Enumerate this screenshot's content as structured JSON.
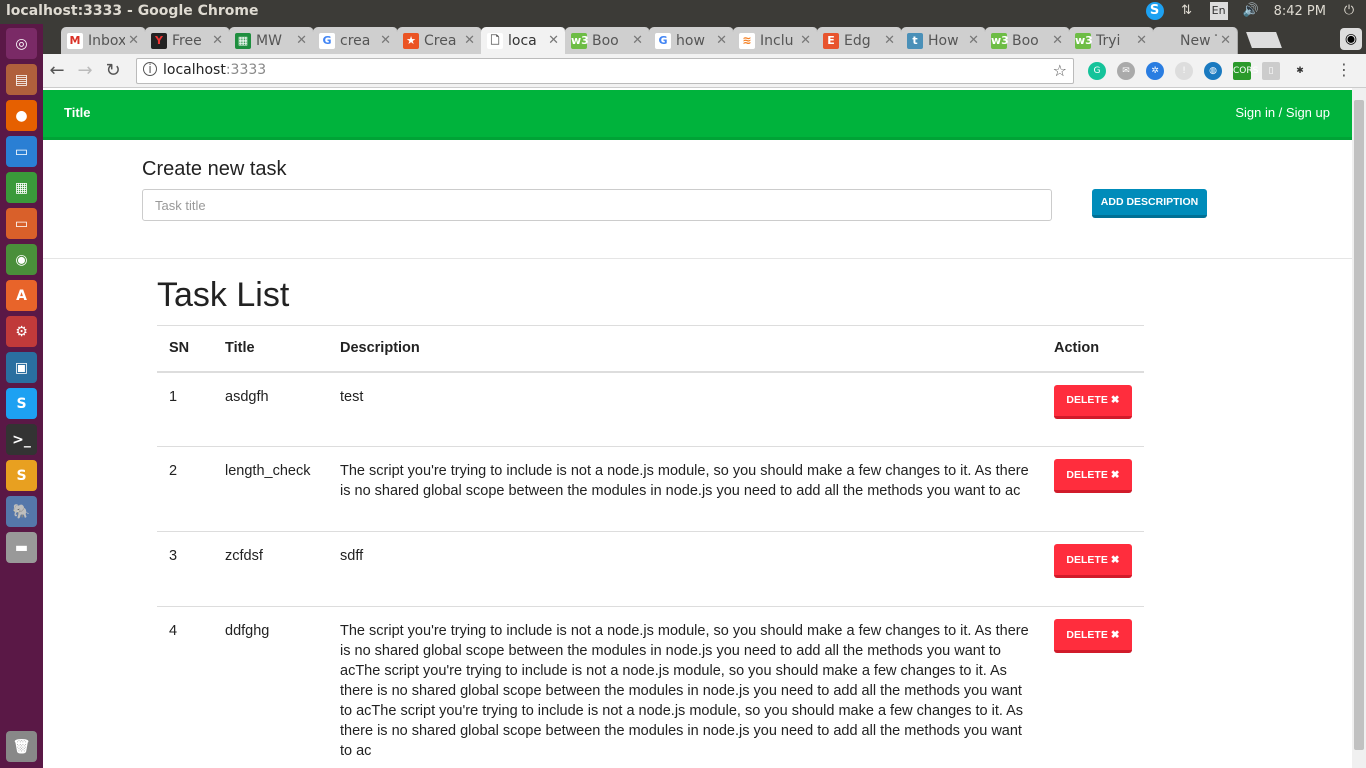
{
  "window": {
    "title": "localhost:3333 - Google Chrome",
    "clock": "8:42 PM",
    "keyboard": "En"
  },
  "tabs": [
    {
      "label": "Inbox",
      "icon": "gmail-icon",
      "color": "#ffffff",
      "fg": "#d93025",
      "glyph": "M"
    },
    {
      "label": "Free",
      "icon": "freecodecamp-icon",
      "color": "#222222",
      "fg": "#e33",
      "glyph": "Y"
    },
    {
      "label": "MW",
      "icon": "sheets-icon",
      "color": "#1e8e3e",
      "fg": "#fff",
      "glyph": "▦"
    },
    {
      "label": "crea",
      "icon": "google-icon",
      "color": "#ffffff",
      "fg": "#4285f4",
      "glyph": "G"
    },
    {
      "label": "Crea",
      "icon": "auth0-icon",
      "color": "#eb5424",
      "fg": "#fff",
      "glyph": "★"
    },
    {
      "label": "loca",
      "icon": "page-icon",
      "color": "#ffffff",
      "fg": "#555",
      "glyph": "🗋",
      "active": true
    },
    {
      "label": "Boo",
      "icon": "w3schools-icon",
      "color": "#6dbd45",
      "fg": "#fff",
      "glyph": "w3"
    },
    {
      "label": "how",
      "icon": "google-icon",
      "color": "#ffffff",
      "fg": "#4285f4",
      "glyph": "G"
    },
    {
      "label": "Inclu",
      "icon": "stackoverflow-icon",
      "color": "#ffffff",
      "fg": "#f48024",
      "glyph": "≋"
    },
    {
      "label": "Edg",
      "icon": "edge-icon",
      "color": "#e8542e",
      "fg": "#fff",
      "glyph": "E"
    },
    {
      "label": "How",
      "icon": "t-icon",
      "color": "#4a90b8",
      "fg": "#fff",
      "glyph": "t"
    },
    {
      "label": "Boo",
      "icon": "w3schools-icon",
      "color": "#6dbd45",
      "fg": "#fff",
      "glyph": "w3"
    },
    {
      "label": "Tryi",
      "icon": "w3schools-icon",
      "color": "#6dbd45",
      "fg": "#fff",
      "glyph": "w3"
    },
    {
      "label": "New Ta",
      "icon": "none",
      "color": "transparent",
      "fg": "#555",
      "glyph": ""
    }
  ],
  "address": {
    "host": "localhost",
    "port": ":3333"
  },
  "app": {
    "brand": "Title",
    "signin": "Sign in / Sign up",
    "create_heading": "Create new task",
    "task_placeholder": "Task title",
    "add_description": "ADD DESCRIPTION",
    "list_title": "Task List",
    "columns": [
      "SN",
      "Title",
      "Description",
      "Action"
    ],
    "delete_label": "DELETE ✖",
    "rows": [
      {
        "sn": "1",
        "title": "asdgfh",
        "description": "test"
      },
      {
        "sn": "2",
        "title": "length_check",
        "description": "The script you're trying to include is not a node.js module, so you should make a few changes to it. As there is no shared global scope between the modules in node.js you need to add all the methods you want to ac"
      },
      {
        "sn": "3",
        "title": "zcfdsf",
        "description": "sdff"
      },
      {
        "sn": "4",
        "title": "ddfghg",
        "description": "The script you're trying to include is not a node.js module, so you should make a few changes to it. As there is no shared global scope between the modules in node.js you need to add all the methods you want to acThe script you're trying to include is not a node.js module, so you should make a few changes to it. As there is no shared global scope between the modules in node.js you need to add all the methods you want to acThe script you're trying to include is not a node.js module, so you should make a few changes to it. As there is no shared global scope between the modules in node.js you need to add all the methods you want to ac"
      }
    ]
  },
  "colors": {
    "navbar": "#00b33c",
    "primary": "#008cba",
    "danger": "#ff2d3d"
  }
}
